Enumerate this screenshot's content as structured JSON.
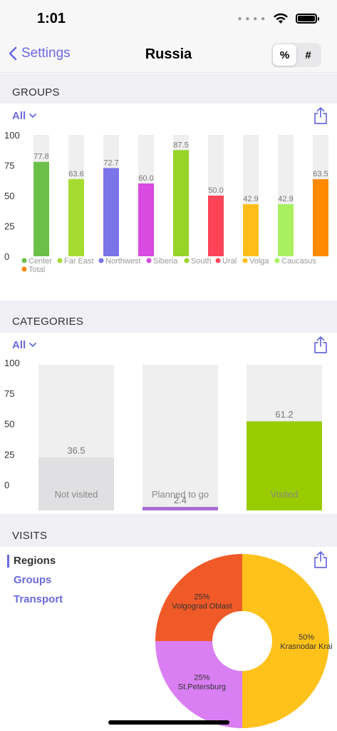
{
  "status_bar": {
    "time": "1:01"
  },
  "nav": {
    "back_label": "Settings",
    "title": "Russia",
    "segments": [
      "%",
      "#"
    ],
    "selected_segment": "%"
  },
  "colors": {
    "accent": "#6a6adf",
    "section_bg": "#efeff4",
    "bar_track": "#efefef"
  },
  "groups": {
    "header": "GROUPS",
    "filter": "All",
    "chart_data": {
      "type": "bar",
      "title": "",
      "xlabel": "",
      "ylabel": "",
      "ylim": [
        0,
        100
      ],
      "yticks": [
        "100",
        "75",
        "50",
        "25",
        "0"
      ],
      "categories": [
        "Center",
        "Far East",
        "Northwest",
        "Siberia",
        "South",
        "Ural",
        "Volga",
        "Caucasus",
        "Total"
      ],
      "values": [
        77.8,
        63.6,
        72.7,
        60.0,
        87.5,
        50.0,
        42.9,
        42.9,
        63.5
      ],
      "value_labels": [
        "77.8",
        "63.6",
        "72.7",
        "60.0",
        "87.5",
        "50.0",
        "42.9",
        "42.9",
        "63.5"
      ],
      "colors": [
        "#6cc04a",
        "#a6dc32",
        "#7b73e8",
        "#d84ae0",
        "#96d428",
        "#ff4458",
        "#ffbe1a",
        "#a8f060",
        "#ff8a00"
      ],
      "legend_placement": "bottom"
    }
  },
  "categories": {
    "header": "CATEGORIES",
    "filter": "All",
    "chart_data": {
      "type": "bar",
      "title": "",
      "xlabel": "",
      "ylabel": "",
      "ylim": [
        0,
        100
      ],
      "yticks": [
        "100",
        "75",
        "50",
        "25",
        "0"
      ],
      "categories": [
        "Not visited",
        "Planned to go",
        "Visited"
      ],
      "values": [
        36.5,
        2.4,
        61.2
      ],
      "value_labels": [
        "36.5",
        "2.4",
        "61.2"
      ],
      "colors": [
        "#e0e0e2",
        "#a86cd4",
        "#99cc00"
      ]
    }
  },
  "visits": {
    "header": "VISITS",
    "menu": [
      "Regions",
      "Groups",
      "Transport"
    ],
    "selected": "Regions",
    "chart_data": {
      "type": "pie",
      "title": "",
      "slices": [
        {
          "label": "Krasnodar Krai",
          "value": 50,
          "percent_label": "50%",
          "color": "#ffc21a"
        },
        {
          "label": "St.Petersburg",
          "value": 25,
          "percent_label": "25%",
          "color": "#d97ef3"
        },
        {
          "label": "Volgograd Oblast",
          "value": 25,
          "percent_label": "25%",
          "color": "#f05a28"
        }
      ]
    }
  }
}
